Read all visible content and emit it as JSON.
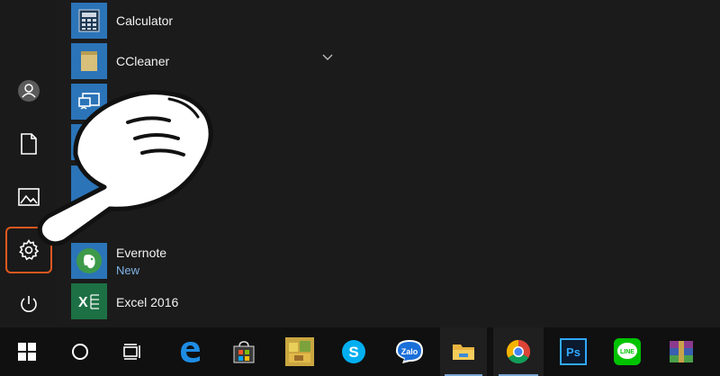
{
  "start_menu": {
    "rail": {
      "items": [
        {
          "name": "user-account-icon"
        },
        {
          "name": "documents-icon"
        },
        {
          "name": "pictures-icon"
        },
        {
          "name": "settings-icon",
          "highlighted": true
        },
        {
          "name": "power-icon"
        }
      ],
      "highlight_color": "#e0581f"
    },
    "apps": [
      {
        "label": "Calculator",
        "tile_color": "#2b74b8",
        "icon": "calculator-icon"
      },
      {
        "label": "CCleaner",
        "tile_color": "#2b74b8",
        "icon": "ccleaner-icon",
        "has_expand": true
      },
      {
        "label": "",
        "tile_color": "#2b74b8",
        "icon": "connect-icon"
      },
      {
        "label": "Evernote",
        "sublabel": "New",
        "tile_color": "#2b74b8",
        "icon": "evernote-icon"
      },
      {
        "label": "Excel 2016",
        "tile_color": "#1d7044",
        "icon": "excel-icon"
      }
    ]
  },
  "taskbar": {
    "items": [
      {
        "name": "windows-start-icon"
      },
      {
        "name": "search-circle-icon"
      },
      {
        "name": "task-view-icon"
      },
      {
        "name": "edge-icon"
      },
      {
        "name": "store-icon"
      },
      {
        "name": "game-icon"
      },
      {
        "name": "skype-icon",
        "text": "S"
      },
      {
        "name": "zalo-icon",
        "text": "Zalo"
      },
      {
        "name": "file-explorer-icon"
      },
      {
        "name": "chrome-icon"
      },
      {
        "name": "photoshop-icon",
        "text": "Ps"
      },
      {
        "name": "line-icon",
        "text": "LINE"
      },
      {
        "name": "winrar-icon"
      }
    ],
    "accent": "#7aa6d6"
  }
}
